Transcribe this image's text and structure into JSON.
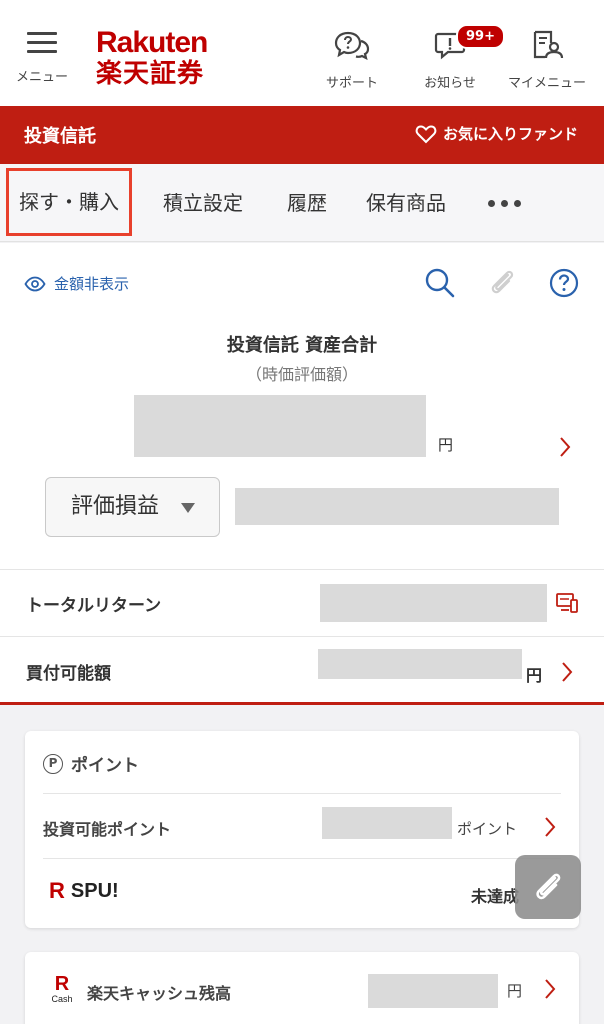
{
  "header": {
    "menu_label": "メニュー",
    "logo_en": "Rakuten",
    "logo_jp": "楽天証券",
    "support_label": "サポート",
    "notice_label": "お知らせ",
    "notice_badge": "99+",
    "mymenu_label": "マイメニュー"
  },
  "section_bar": {
    "title": "投資信託",
    "favorite_label": "お気に入りファンド"
  },
  "tabs": [
    {
      "label": "探す・購入",
      "active": true
    },
    {
      "label": "積立設定"
    },
    {
      "label": "履歴"
    },
    {
      "label": "保有商品"
    }
  ],
  "summary": {
    "hide_amount_label": "金額非表示",
    "title": "投資信託 資産合計",
    "subtitle": "（時価評価額）",
    "currency": "円",
    "metric_select": "評価損益"
  },
  "rows": {
    "total_return_label": "トータルリターン",
    "buying_power_label": "買付可能額",
    "buying_power_currency": "円"
  },
  "points": {
    "header": "ポイント",
    "header_icon_letter": "P",
    "investable_label": "投資可能ポイント",
    "investable_unit": "ポイント",
    "spu_logo_letter": "R",
    "spu_label": "SPU!",
    "spu_status": "未達成"
  },
  "cash": {
    "icon_letter": "R",
    "icon_caption": "Cash",
    "label": "楽天キャッシュ残高",
    "currency": "円"
  },
  "colors": {
    "brand_red": "#bf0000",
    "bar_red": "#bf1e12",
    "link_blue": "#2a62ad",
    "active_tab_outline": "#e8402c"
  }
}
